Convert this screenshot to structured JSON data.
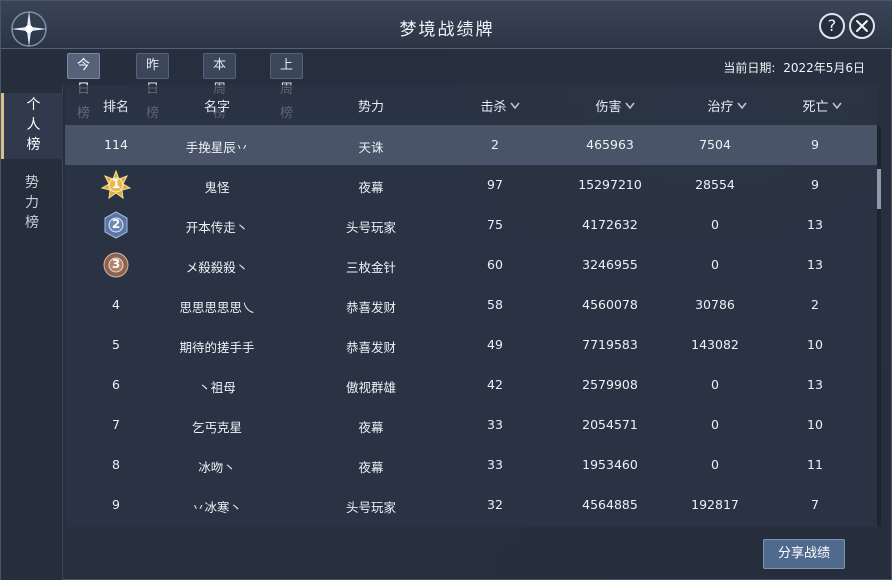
{
  "title": "梦境战绩牌",
  "tabs": [
    {
      "label": "今日榜",
      "active": true
    },
    {
      "label": "昨日榜",
      "active": false
    },
    {
      "label": "本周榜",
      "active": false
    },
    {
      "label": "上周榜",
      "active": false
    }
  ],
  "date": {
    "label": "当前日期:",
    "value": "2022年5月6日"
  },
  "side_tabs": [
    {
      "label": "个人榜",
      "active": true
    },
    {
      "label": "势力榜",
      "active": false
    }
  ],
  "columns": {
    "rank": "排名",
    "name": "名字",
    "faction": "势力",
    "kills": "击杀",
    "damage": "伤害",
    "heal": "治疗",
    "deaths": "死亡"
  },
  "self_row": {
    "rank": "114",
    "name": "手挽星辰丷",
    "faction": "天诛",
    "kills": "2",
    "damage": "465963",
    "heal": "7504",
    "deaths": "9"
  },
  "rows": [
    {
      "rank": "1",
      "name": "鬼怪",
      "faction": "夜幕",
      "kills": "97",
      "damage": "15297210",
      "heal": "28554",
      "deaths": "9",
      "badge": "gold"
    },
    {
      "rank": "2",
      "name": "开本传走丶",
      "faction": "头号玩家",
      "kills": "75",
      "damage": "4172632",
      "heal": "0",
      "deaths": "13",
      "badge": "silver"
    },
    {
      "rank": "3",
      "name": "メ殺殺殺丶",
      "faction": "三枚金针",
      "kills": "60",
      "damage": "3246955",
      "heal": "0",
      "deaths": "13",
      "badge": "bronze"
    },
    {
      "rank": "4",
      "name": "思思思思思乀",
      "faction": "恭喜发财",
      "kills": "58",
      "damage": "4560078",
      "heal": "30786",
      "deaths": "2"
    },
    {
      "rank": "5",
      "name": "期待的搓手手",
      "faction": "恭喜发财",
      "kills": "49",
      "damage": "7719583",
      "heal": "143082",
      "deaths": "10"
    },
    {
      "rank": "6",
      "name": "丶祖母",
      "faction": "傲视群雄",
      "kills": "42",
      "damage": "2579908",
      "heal": "0",
      "deaths": "13"
    },
    {
      "rank": "7",
      "name": "乞丐克星",
      "faction": "夜幕",
      "kills": "33",
      "damage": "2054571",
      "heal": "0",
      "deaths": "10"
    },
    {
      "rank": "8",
      "name": "冰吻丶",
      "faction": "夜幕",
      "kills": "33",
      "damage": "1953460",
      "heal": "0",
      "deaths": "11"
    },
    {
      "rank": "9",
      "name": "丷冰寒丶",
      "faction": "头号玩家",
      "kills": "32",
      "damage": "4564885",
      "heal": "192817",
      "deaths": "7"
    }
  ],
  "share_label": "分享战绩",
  "icons": {
    "help": "question-icon",
    "close": "close-icon",
    "sort": "chevron-down-icon",
    "rank_badge": "medal-icon"
  },
  "colors": {
    "panel_bg": "#262e3d",
    "highlight_row": "#4a5468",
    "gold": "#d9a94a",
    "silver": "#6d86b8",
    "bronze": "#b0826a"
  }
}
